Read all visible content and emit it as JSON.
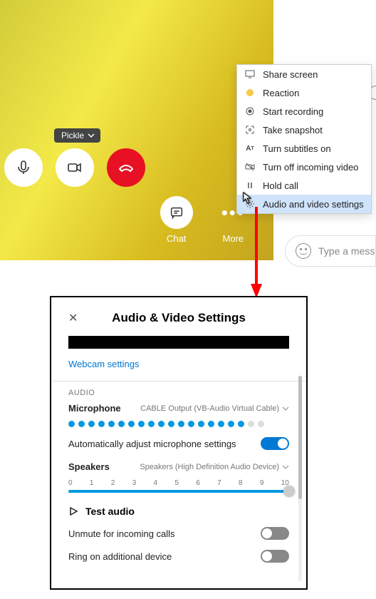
{
  "call": {
    "participant_name": "Pickle",
    "chat_label": "Chat",
    "more_label": "More",
    "message_placeholder": "Type a mess"
  },
  "context_menu": {
    "items": [
      {
        "label": "Share screen",
        "icon": "share-screen-icon"
      },
      {
        "label": "Reaction",
        "icon": "reaction-icon"
      },
      {
        "label": "Start recording",
        "icon": "record-icon"
      },
      {
        "label": "Take snapshot",
        "icon": "snapshot-icon"
      },
      {
        "label": "Turn subtitles on",
        "icon": "subtitles-icon"
      },
      {
        "label": "Turn off incoming video",
        "icon": "video-off-icon"
      },
      {
        "label": "Hold call",
        "icon": "hold-icon"
      },
      {
        "label": "Audio and video settings",
        "icon": "gear-icon"
      }
    ],
    "selected_index": 7
  },
  "settings": {
    "title": "Audio & Video Settings",
    "webcam_link": "Webcam settings",
    "audio_section": "AUDIO",
    "mic_label": "Microphone",
    "mic_device": "CABLE Output (VB-Audio Virtual Cable)",
    "mic_level_on": 18,
    "mic_level_total": 20,
    "auto_adjust_label": "Automatically adjust microphone settings",
    "auto_adjust_on": true,
    "speakers_label": "Speakers",
    "speakers_device": "Speakers (High Definition Audio Device)",
    "slider_ticks": [
      "0",
      "1",
      "2",
      "3",
      "4",
      "5",
      "6",
      "7",
      "8",
      "9",
      "10"
    ],
    "slider_value": 10,
    "slider_max": 10,
    "test_audio_label": "Test audio",
    "unmute_label": "Unmute for incoming calls",
    "unmute_on": false,
    "ring_label": "Ring on additional device",
    "ring_on": false
  }
}
